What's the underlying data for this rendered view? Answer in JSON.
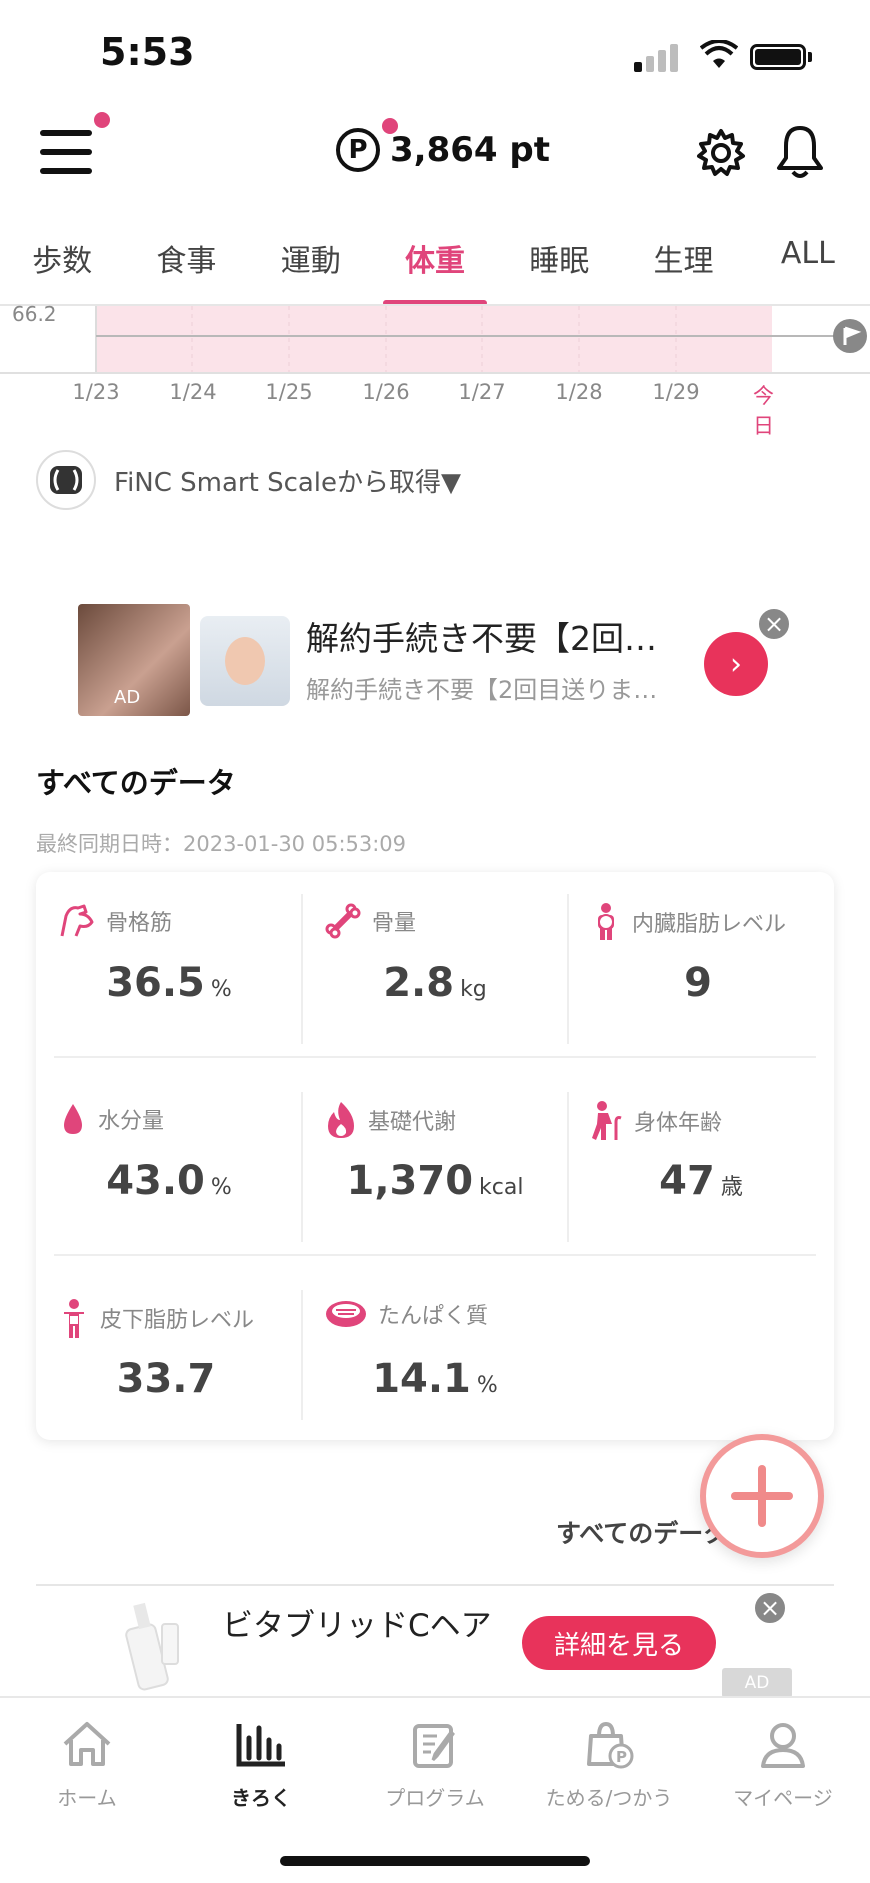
{
  "status_bar": {
    "time": "5:53"
  },
  "header": {
    "points": "3,864 pt",
    "points_symbol": "P"
  },
  "tabs": [
    {
      "label": "歩数",
      "active": false
    },
    {
      "label": "食事",
      "active": false
    },
    {
      "label": "運動",
      "active": false
    },
    {
      "label": "体重",
      "active": true
    },
    {
      "label": "睡眠",
      "active": false
    },
    {
      "label": "生理",
      "active": false
    },
    {
      "label": "ALL",
      "active": false
    }
  ],
  "chart_data": {
    "type": "line",
    "y_label_visible": "66.2",
    "categories": [
      "1/23",
      "1/24",
      "1/25",
      "1/26",
      "1/27",
      "1/28",
      "1/29",
      "今日"
    ],
    "highlight_color": "#fbe3e9"
  },
  "source": {
    "text": "FiNC Smart Scaleから取得▼"
  },
  "ad1": {
    "title": "解約手続き不要【2回…",
    "subtitle": "解約手続き不要【2回目送りま…",
    "tag": "AD"
  },
  "section": {
    "title": "すべてのデータ",
    "sync": "最終同期日時：2023-01-30 05:53:09"
  },
  "metrics": [
    {
      "icon": "muscle-icon",
      "label": "骨格筋",
      "value": "36.5",
      "unit": "%"
    },
    {
      "icon": "bone-icon",
      "label": "骨量",
      "value": "2.8",
      "unit": "kg"
    },
    {
      "icon": "visceral-fat-icon",
      "label": "内臓脂肪レベル",
      "value": "9",
      "unit": ""
    },
    {
      "icon": "water-drop-icon",
      "label": "水分量",
      "value": "43.0",
      "unit": "%"
    },
    {
      "icon": "flame-icon",
      "label": "基礎代謝",
      "value": "1,370",
      "unit": "kcal"
    },
    {
      "icon": "elderly-icon",
      "label": "身体年齢",
      "value": "47",
      "unit": "歳"
    },
    {
      "icon": "body-icon",
      "label": "皮下脂肪レベル",
      "value": "33.7",
      "unit": ""
    },
    {
      "icon": "meat-icon",
      "label": "たんぱく質",
      "value": "14.1",
      "unit": "%"
    }
  ],
  "all_data_link": "すべてのデータ ›",
  "ad2": {
    "title": "ビタブリッドCヘア",
    "button": "詳細を見る",
    "tag": "AD"
  },
  "nav": [
    {
      "label": "ホーム",
      "icon": "home-icon",
      "active": false
    },
    {
      "label": "きろく",
      "icon": "chart-icon",
      "active": true
    },
    {
      "label": "プログラム",
      "icon": "program-icon",
      "active": false
    },
    {
      "label": "ためる/つかう",
      "icon": "points-bag-icon",
      "active": false
    },
    {
      "label": "マイページ",
      "icon": "user-icon",
      "active": false
    }
  ],
  "colors": {
    "accent": "#e0457b",
    "ad_button": "#e8335b",
    "fab_ring": "#f39a9a"
  }
}
